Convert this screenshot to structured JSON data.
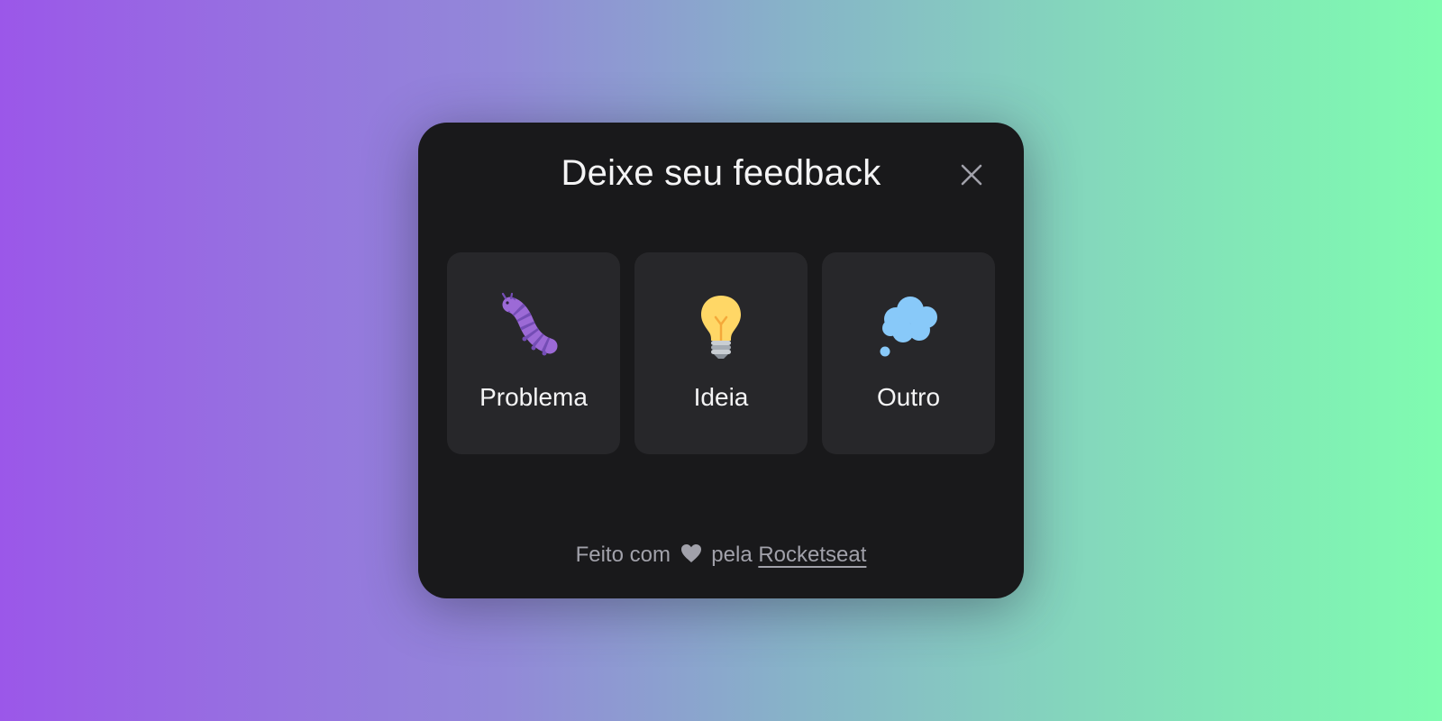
{
  "widget": {
    "title": "Deixe seu feedback",
    "close_icon": "close-icon"
  },
  "options": [
    {
      "label": "Problema",
      "icon": "bug-caterpillar-icon"
    },
    {
      "label": "Ideia",
      "icon": "lightbulb-icon"
    },
    {
      "label": "Outro",
      "icon": "thought-bubble-icon"
    }
  ],
  "footer": {
    "prefix": "Feito com",
    "heart_icon": "heart-icon",
    "middle": "pela",
    "link_text": "Rocketseat"
  },
  "colors": {
    "card_background": "#19191b",
    "option_background": "#27272a",
    "text": "#f4f4f5",
    "muted_text": "#a1a1aa"
  }
}
